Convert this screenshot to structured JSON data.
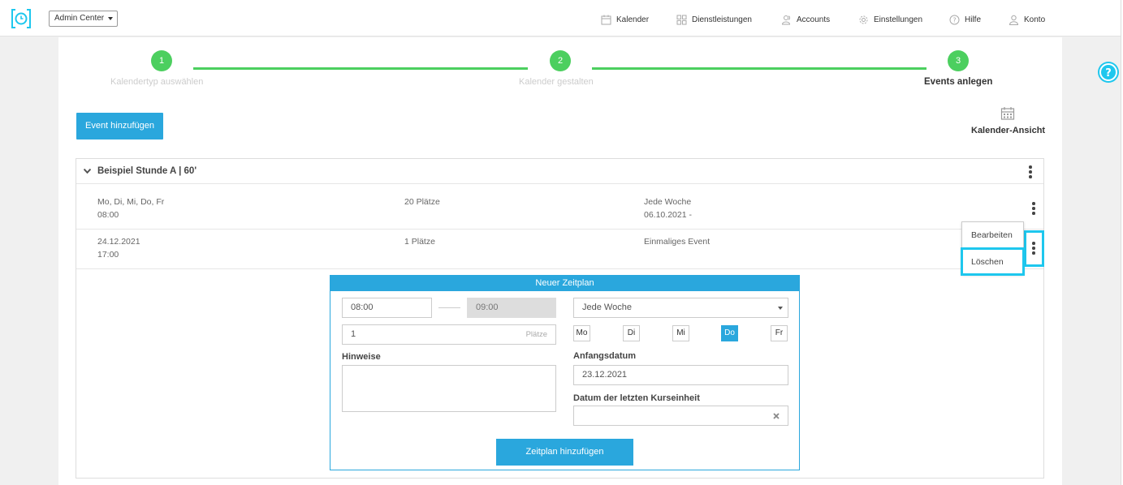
{
  "header": {
    "admin_select": "Admin Center",
    "nav": [
      {
        "label": "Kalender",
        "icon": "calendar-icon"
      },
      {
        "label": "Dienstleistungen",
        "icon": "grid-icon"
      },
      {
        "label": "Accounts",
        "icon": "users-icon"
      },
      {
        "label": "Einstellungen",
        "icon": "gear-icon"
      },
      {
        "label": "Hilfe",
        "icon": "question-icon"
      },
      {
        "label": "Konto",
        "icon": "user-icon"
      }
    ]
  },
  "stepper": {
    "steps": [
      {
        "number": "1",
        "label": "Kalendertyp auswählen",
        "active": false
      },
      {
        "number": "2",
        "label": "Kalender gestalten",
        "active": false
      },
      {
        "number": "3",
        "label": "Events anlegen",
        "active": true
      }
    ],
    "color": "#4ccf5f"
  },
  "actions": {
    "add_event": "Event hinzufügen",
    "calendar_view": "Kalender-Ansicht"
  },
  "event": {
    "title": "Beispiel Stunde A | 60'",
    "schedules": [
      {
        "days": "Mo, Di, Mi, Do, Fr",
        "time": "08:00",
        "places": "20 Plätze",
        "recurrence": "Jede Woche",
        "date": "06.10.2021 -"
      },
      {
        "days": "24.12.2021",
        "time": "17:00",
        "places": "1 Plätze",
        "recurrence": "Einmaliges Event",
        "date": ""
      }
    ],
    "menu": {
      "edit": "Bearbeiten",
      "delete": "Löschen"
    }
  },
  "form": {
    "title": "Neuer Zeitplan",
    "start_time": "08:00",
    "end_time": "09:00",
    "recurrence": "Jede Woche",
    "places_value": "1",
    "places_suffix": "Plätze",
    "days": [
      {
        "label": "Mo",
        "selected": false
      },
      {
        "label": "Di",
        "selected": false
      },
      {
        "label": "Mi",
        "selected": false
      },
      {
        "label": "Do",
        "selected": true
      },
      {
        "label": "Fr",
        "selected": false
      }
    ],
    "notes_label": "Hinweise",
    "start_date_label": "Anfangsdatum",
    "start_date": "23.12.2021",
    "end_date_label": "Datum der letzten Kurseinheit",
    "end_date": "",
    "submit": "Zeitplan hinzufügen"
  },
  "colors": {
    "accent": "#2aa7dd",
    "highlight": "#1ec7ee",
    "step_green": "#4ccf5f"
  }
}
